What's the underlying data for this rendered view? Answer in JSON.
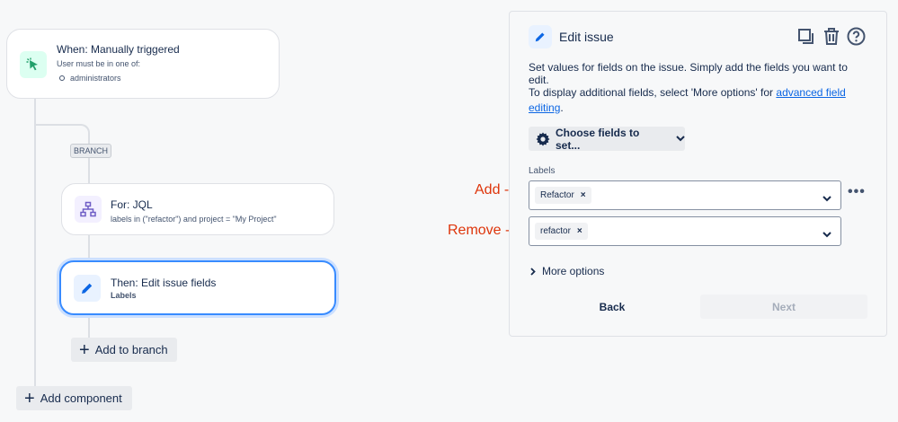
{
  "trigger": {
    "title": "When: Manually triggered",
    "subtitle": "User must be in one of:",
    "groups": [
      "administrators"
    ]
  },
  "branch": {
    "badge": "BRANCH"
  },
  "for_node": {
    "title": "For: JQL",
    "query": "labels in (\"refactor\") and project = \"My Project\""
  },
  "then_node": {
    "title": "Then: Edit issue fields",
    "subtitle": "Labels"
  },
  "add_to_branch_label": "Add to branch",
  "add_component_label": "Add component",
  "panel": {
    "title": "Edit issue",
    "description": "Set values for fields on the issue. Simply add the fields you want to edit.",
    "info_prefix": "To display additional fields, select 'More options' for ",
    "info_link": "advanced field editing",
    "info_suffix": ".",
    "choose_fields_label": "Choose fields to set...",
    "field_label": "Labels",
    "add_value": "Refactor",
    "remove_value": "refactor",
    "more_options_label": "More options",
    "back_label": "Back",
    "next_label": "Next"
  },
  "annotations": {
    "add": "Add ->",
    "remove": "Remove ->"
  },
  "colors": {
    "trigger_icon_bg": "#dcfff1",
    "trigger_icon": "#22a06b",
    "for_icon_bg": "#f3f0ff",
    "for_icon": "#6e5dc6",
    "then_icon_bg": "#e9f2ff",
    "then_icon": "#0c66e4",
    "selected_border": "#388bff",
    "annotation": "#de350b"
  }
}
